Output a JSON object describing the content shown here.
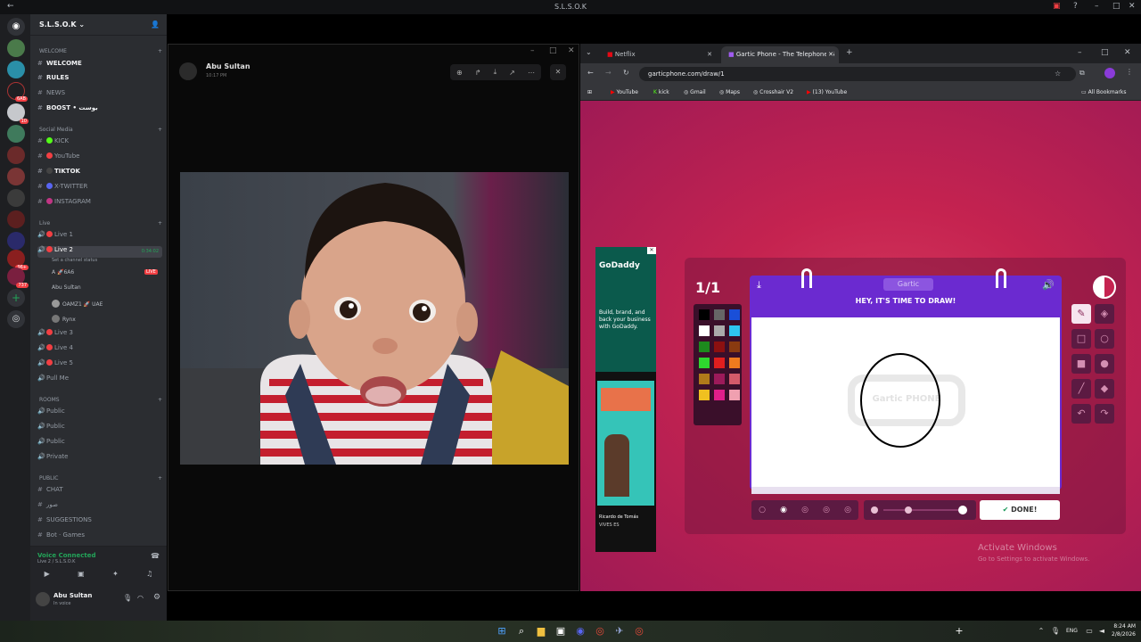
{
  "window": {
    "title": "S.L.S.O.K"
  },
  "server": {
    "name": "S.L.S.O.K"
  },
  "rail_badges": [
    "6AB",
    "10",
    "96+",
    "737"
  ],
  "categories": {
    "welcome": "WELCOME",
    "social": "Social Media",
    "live": "Live",
    "rooms": "ROOMS",
    "public": "PUBLIC"
  },
  "channels": {
    "welcome": "WELCOME",
    "rules": "RULES",
    "news": "NEWS",
    "boost": "BOOST • بوست",
    "kick": "KICK",
    "youtube": "YouTube",
    "tiktok": "TIKTOK",
    "xtwitter": "X-TWITTER",
    "instagram": "INSTAGRAM",
    "live1": "Live 1",
    "live2": "Live 2",
    "live2_time": "0:34:02",
    "live2_status": "Set a channel status",
    "live3": "Live 3",
    "live4": "Live 4",
    "live5": "Live 5",
    "pullme": "Pull Me",
    "pub1": "Public",
    "pub2": "Public",
    "pub3": "Public",
    "private": "Private",
    "chat": "CHAT",
    "sowar": "صور",
    "suggestions": "SUGGESTIONS",
    "botgames": "Bot · Games"
  },
  "members": [
    {
      "name": "A 🚀6A6",
      "live": "LIVE"
    },
    {
      "name": "Abu Sultan"
    },
    {
      "name": "OAMZ1 🚀 UAE"
    },
    {
      "name": "Rynx"
    }
  ],
  "voice": {
    "status": "Voice Connected",
    "channel": "Live 2 / S.L.S.O.K"
  },
  "user": {
    "name": "Abu Sultan",
    "status": "In voice"
  },
  "popout": {
    "sender": "Abu Sultan",
    "time": "10:17 PM"
  },
  "browser": {
    "tabs": [
      {
        "label": "Netflix"
      },
      {
        "label": "Gartic Phone - The Telephone G"
      }
    ],
    "url": "garticphone.com/draw/1",
    "bookmarks": [
      "YouTube",
      "kick",
      "Gmail",
      "Maps",
      "Crosshair V2",
      "(13) YouTube"
    ],
    "all_bookmarks": "All Bookmarks"
  },
  "ad": {
    "brand": "GoDaddy",
    "text": "Build, brand, and back your business with GoDaddy.",
    "caption": "Ricardo de Tomás",
    "caption2": "VIVES ES"
  },
  "game": {
    "round": "1/1",
    "logo": "Gartic",
    "prompt": "HEY, IT'S TIME TO DRAW!",
    "done_label": "DONE!",
    "watermark": "Gartic PHONE"
  },
  "palette": [
    "#000000",
    "#666666",
    "#1a4fd8",
    "#ffffff",
    "#aaaaaa",
    "#2ec5f0",
    "#1d8a1d",
    "#8c1010",
    "#8a3a10",
    "#2ed62e",
    "#e01e1e",
    "#f07a1e",
    "#b07a1a",
    "#9c1a5a",
    "#d45a6a",
    "#f0c020",
    "#e01e8a",
    "#f0a0b0"
  ],
  "activate": {
    "line1": "Activate Windows",
    "line2": "Go to Settings to activate Windows."
  },
  "taskbar": {
    "lang": "ENG",
    "time": "8:24 AM",
    "date": "2/8/2026"
  }
}
